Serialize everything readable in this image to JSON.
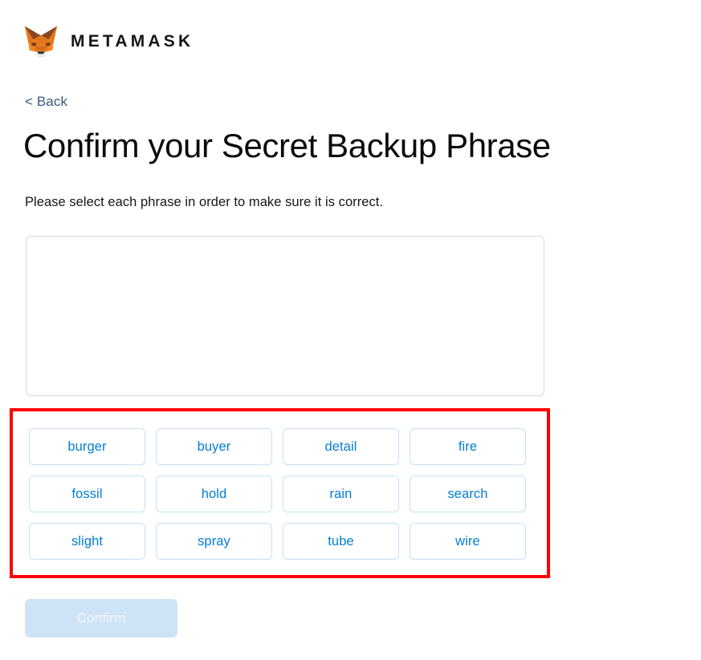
{
  "brand": {
    "logo_icon": "metamask-fox-icon",
    "wordmark": "METAMASK",
    "colors": {
      "fox_orange": "#e2761b",
      "fox_dark_brown": "#763d16",
      "fox_mid_orange": "#e4761b",
      "fox_light": "#f6851b",
      "fox_cream": "#f5f0e8",
      "fox_nose": "#2f343b"
    }
  },
  "nav": {
    "back_label": "< Back"
  },
  "header": {
    "title": "Confirm your Secret Backup Phrase",
    "subtitle": "Please select each phrase in order to make sure it is correct."
  },
  "dropzone": {
    "selected_words": [],
    "border_color": "#d6d9dc"
  },
  "annotation": {
    "color": "#ff0000",
    "border_width_px": 4,
    "target": "word-bank"
  },
  "word_bank": {
    "words": [
      "burger",
      "buyer",
      "detail",
      "fire",
      "fossil",
      "hold",
      "rain",
      "search",
      "slight",
      "spray",
      "tube",
      "wire"
    ],
    "text_color": "#037dd6",
    "border_color": "#c8e0f4"
  },
  "footer": {
    "confirm_label": "Confirm",
    "confirm_disabled": true,
    "confirm_bg": "#cfe3f7",
    "confirm_text_color": "#f3f9fe"
  }
}
